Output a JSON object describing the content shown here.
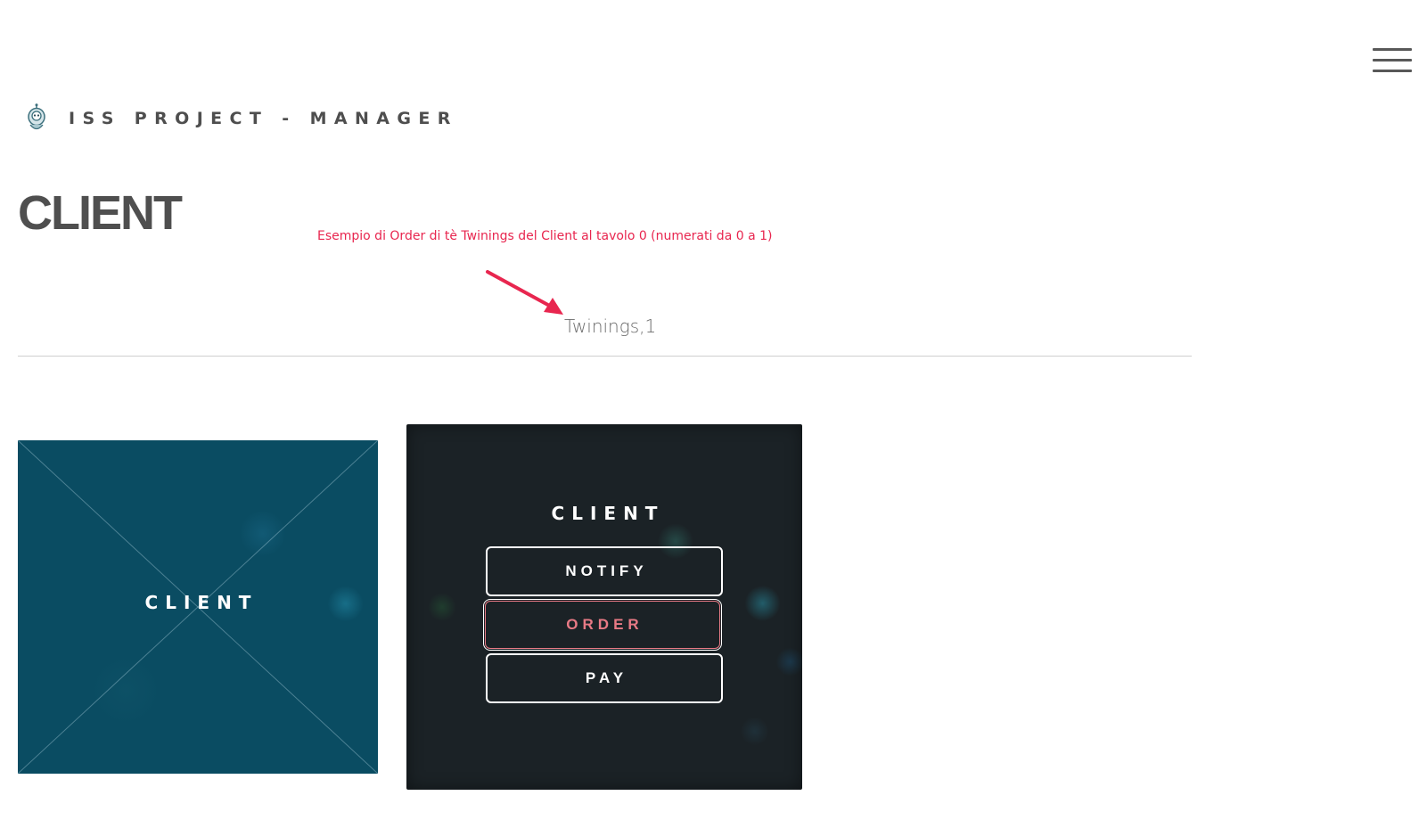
{
  "header": {
    "brand_title": "ISS PROJECT - MANAGER",
    "logo_icon": "robot-icon",
    "menu_icon": "hamburger-menu-icon"
  },
  "page": {
    "title": "CLIENT",
    "annotation_note": "Esempio di Order di tè Twinings del Client al tavolo 0 (numerati da 0 a 1)",
    "annotation_color": "#e8264f",
    "order_value": "Twinings,1"
  },
  "tiles": {
    "left_label": "CLIENT",
    "left_color": "#0a4c62",
    "right": {
      "title": "CLIENT",
      "buttons": [
        {
          "label": "NOTIFY"
        },
        {
          "label": "ORDER",
          "state": "focused",
          "color": "#e87a85"
        },
        {
          "label": "PAY"
        }
      ]
    },
    "right_color": "#1b2226"
  }
}
